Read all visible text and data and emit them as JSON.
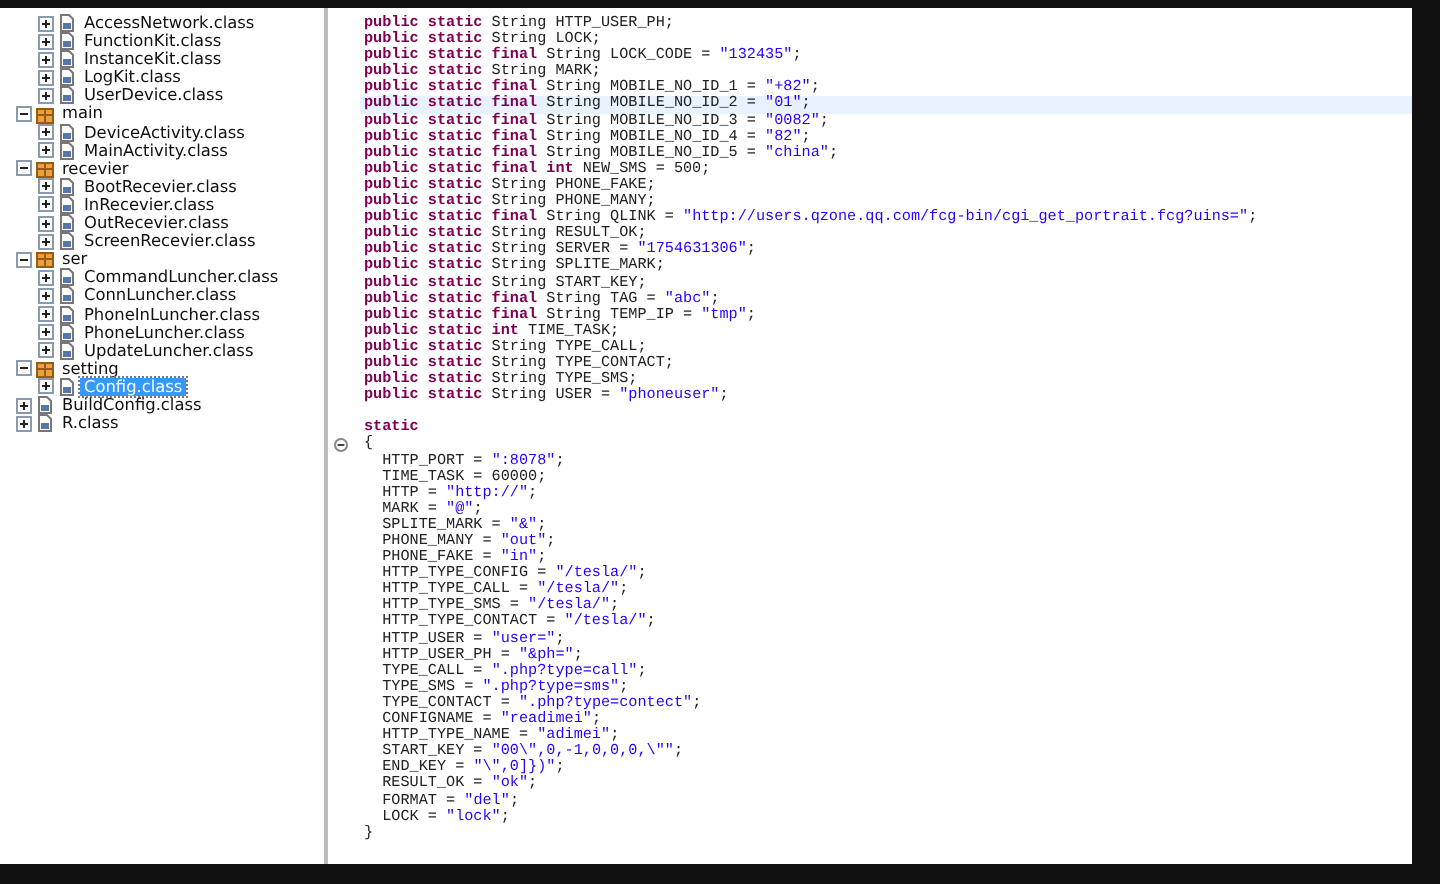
{
  "tree": [
    {
      "children": [
        {
          "label": "AccessNetwork.class",
          "kind": "class",
          "expanded": false,
          "selected": false
        },
        {
          "label": "FunctionKit.class",
          "kind": "class",
          "expanded": false,
          "selected": false
        },
        {
          "label": "InstanceKit.class",
          "kind": "class",
          "expanded": false,
          "selected": false
        },
        {
          "label": "LogKit.class",
          "kind": "class",
          "expanded": false,
          "selected": false
        },
        {
          "label": "UserDevice.class",
          "kind": "class",
          "expanded": false,
          "selected": false
        }
      ]
    },
    {
      "label": "main",
      "kind": "package",
      "expanded": true,
      "selected": false,
      "children": [
        {
          "label": "DeviceActivity.class",
          "kind": "class",
          "expanded": false,
          "selected": false
        },
        {
          "label": "MainActivity.class",
          "kind": "class",
          "expanded": false,
          "selected": false
        }
      ]
    },
    {
      "label": "recevier",
      "kind": "package",
      "expanded": true,
      "selected": false,
      "children": [
        {
          "label": "BootRecevier.class",
          "kind": "class",
          "expanded": false,
          "selected": false
        },
        {
          "label": "InRecevier.class",
          "kind": "class",
          "expanded": false,
          "selected": false
        },
        {
          "label": "OutRecevier.class",
          "kind": "class",
          "expanded": false,
          "selected": false
        },
        {
          "label": "ScreenRecevier.class",
          "kind": "class",
          "expanded": false,
          "selected": false
        }
      ]
    },
    {
      "label": "ser",
      "kind": "package",
      "expanded": true,
      "selected": false,
      "children": [
        {
          "label": "CommandLuncher.class",
          "kind": "class",
          "expanded": false,
          "selected": false
        },
        {
          "label": "ConnLuncher.class",
          "kind": "class",
          "expanded": false,
          "selected": false
        },
        {
          "label": "PhoneInLuncher.class",
          "kind": "class",
          "expanded": false,
          "selected": false
        },
        {
          "label": "PhoneLuncher.class",
          "kind": "class",
          "expanded": false,
          "selected": false
        },
        {
          "label": "UpdateLuncher.class",
          "kind": "class",
          "expanded": false,
          "selected": false
        }
      ]
    },
    {
      "label": "setting",
      "kind": "package",
      "expanded": true,
      "selected": false,
      "children": [
        {
          "label": "Config.class",
          "kind": "class",
          "expanded": false,
          "selected": true
        }
      ]
    },
    {
      "label": "BuildConfig.class",
      "kind": "class",
      "expanded": false,
      "selected": false
    },
    {
      "label": "R.class",
      "kind": "class",
      "expanded": false,
      "selected": false
    }
  ],
  "code": [
    {
      "current": false,
      "fold": false,
      "segments": [
        {
          "kind": "keyword",
          "text": "public static"
        },
        {
          "kind": "plain",
          "text": " String HTTP_USER_PH;"
        }
      ]
    },
    {
      "current": false,
      "fold": false,
      "segments": [
        {
          "kind": "keyword",
          "text": "public static"
        },
        {
          "kind": "plain",
          "text": " String LOCK;"
        }
      ]
    },
    {
      "current": false,
      "fold": false,
      "segments": [
        {
          "kind": "keyword",
          "text": "public static final"
        },
        {
          "kind": "plain",
          "text": " String LOCK_CODE = "
        },
        {
          "kind": "string",
          "text": "\"132435\""
        },
        {
          "kind": "plain",
          "text": ";"
        }
      ]
    },
    {
      "current": false,
      "fold": false,
      "segments": [
        {
          "kind": "keyword",
          "text": "public static"
        },
        {
          "kind": "plain",
          "text": " String MARK;"
        }
      ]
    },
    {
      "current": false,
      "fold": false,
      "segments": [
        {
          "kind": "keyword",
          "text": "public static final"
        },
        {
          "kind": "plain",
          "text": " String MOBILE_NO_ID_1 = "
        },
        {
          "kind": "string",
          "text": "\"+82\""
        },
        {
          "kind": "plain",
          "text": ";"
        }
      ]
    },
    {
      "current": true,
      "fold": false,
      "segments": [
        {
          "kind": "keyword",
          "text": "public static final"
        },
        {
          "kind": "plain",
          "text": " String MOBILE_NO_ID_2 = "
        },
        {
          "kind": "string",
          "text": "\"01\""
        },
        {
          "kind": "plain",
          "text": ";"
        }
      ]
    },
    {
      "current": false,
      "fold": false,
      "segments": [
        {
          "kind": "keyword",
          "text": "public static final"
        },
        {
          "kind": "plain",
          "text": " String MOBILE_NO_ID_3 = "
        },
        {
          "kind": "string",
          "text": "\"0082\""
        },
        {
          "kind": "plain",
          "text": ";"
        }
      ]
    },
    {
      "current": false,
      "fold": false,
      "segments": [
        {
          "kind": "keyword",
          "text": "public static final"
        },
        {
          "kind": "plain",
          "text": " String MOBILE_NO_ID_4 = "
        },
        {
          "kind": "string",
          "text": "\"82\""
        },
        {
          "kind": "plain",
          "text": ";"
        }
      ]
    },
    {
      "current": false,
      "fold": false,
      "segments": [
        {
          "kind": "keyword",
          "text": "public static final"
        },
        {
          "kind": "plain",
          "text": " String MOBILE_NO_ID_5 = "
        },
        {
          "kind": "string",
          "text": "\"china\""
        },
        {
          "kind": "plain",
          "text": ";"
        }
      ]
    },
    {
      "current": false,
      "fold": false,
      "segments": [
        {
          "kind": "keyword",
          "text": "public static final int"
        },
        {
          "kind": "plain",
          "text": " NEW_SMS = 500;"
        }
      ]
    },
    {
      "current": false,
      "fold": false,
      "segments": [
        {
          "kind": "keyword",
          "text": "public static"
        },
        {
          "kind": "plain",
          "text": " String PHONE_FAKE;"
        }
      ]
    },
    {
      "current": false,
      "fold": false,
      "segments": [
        {
          "kind": "keyword",
          "text": "public static"
        },
        {
          "kind": "plain",
          "text": " String PHONE_MANY;"
        }
      ]
    },
    {
      "current": false,
      "fold": false,
      "segments": [
        {
          "kind": "keyword",
          "text": "public static final"
        },
        {
          "kind": "plain",
          "text": " String QLINK = "
        },
        {
          "kind": "string",
          "text": "\"http://users.qzone.qq.com/fcg-bin/cgi_get_portrait.fcg?uins=\""
        },
        {
          "kind": "plain",
          "text": ";"
        }
      ]
    },
    {
      "current": false,
      "fold": false,
      "segments": [
        {
          "kind": "keyword",
          "text": "public static"
        },
        {
          "kind": "plain",
          "text": " String RESULT_OK;"
        }
      ]
    },
    {
      "current": false,
      "fold": false,
      "segments": [
        {
          "kind": "keyword",
          "text": "public static"
        },
        {
          "kind": "plain",
          "text": " String SERVER = "
        },
        {
          "kind": "string",
          "text": "\"1754631306\""
        },
        {
          "kind": "plain",
          "text": ";"
        }
      ]
    },
    {
      "current": false,
      "fold": false,
      "segments": [
        {
          "kind": "keyword",
          "text": "public static"
        },
        {
          "kind": "plain",
          "text": " String SPLITE_MARK;"
        }
      ]
    },
    {
      "current": false,
      "fold": false,
      "segments": [
        {
          "kind": "keyword",
          "text": "public static"
        },
        {
          "kind": "plain",
          "text": " String START_KEY;"
        }
      ]
    },
    {
      "current": false,
      "fold": false,
      "segments": [
        {
          "kind": "keyword",
          "text": "public static final"
        },
        {
          "kind": "plain",
          "text": " String TAG = "
        },
        {
          "kind": "string",
          "text": "\"abc\""
        },
        {
          "kind": "plain",
          "text": ";"
        }
      ]
    },
    {
      "current": false,
      "fold": false,
      "segments": [
        {
          "kind": "keyword",
          "text": "public static final"
        },
        {
          "kind": "plain",
          "text": " String TEMP_IP = "
        },
        {
          "kind": "string",
          "text": "\"tmp\""
        },
        {
          "kind": "plain",
          "text": ";"
        }
      ]
    },
    {
      "current": false,
      "fold": false,
      "segments": [
        {
          "kind": "keyword",
          "text": "public static int"
        },
        {
          "kind": "plain",
          "text": " TIME_TASK;"
        }
      ]
    },
    {
      "current": false,
      "fold": false,
      "segments": [
        {
          "kind": "keyword",
          "text": "public static"
        },
        {
          "kind": "plain",
          "text": " String TYPE_CALL;"
        }
      ]
    },
    {
      "current": false,
      "fold": false,
      "segments": [
        {
          "kind": "keyword",
          "text": "public static"
        },
        {
          "kind": "plain",
          "text": " String TYPE_CONTACT;"
        }
      ]
    },
    {
      "current": false,
      "fold": false,
      "segments": [
        {
          "kind": "keyword",
          "text": "public static"
        },
        {
          "kind": "plain",
          "text": " String TYPE_SMS;"
        }
      ]
    },
    {
      "current": false,
      "fold": false,
      "segments": [
        {
          "kind": "keyword",
          "text": "public static"
        },
        {
          "kind": "plain",
          "text": " String USER = "
        },
        {
          "kind": "string",
          "text": "\"phoneuser\""
        },
        {
          "kind": "plain",
          "text": ";"
        }
      ]
    },
    {
      "current": false,
      "fold": false
    },
    {
      "current": false,
      "fold": false,
      "segments": [
        {
          "kind": "keyword",
          "text": "static"
        }
      ]
    },
    {
      "current": false,
      "fold": true,
      "segments": [
        {
          "kind": "plain",
          "text": "{"
        }
      ]
    },
    {
      "current": false,
      "fold": false,
      "segments": [
        {
          "kind": "plain",
          "text": "  HTTP_PORT = "
        },
        {
          "kind": "string",
          "text": "\":8078\""
        },
        {
          "kind": "plain",
          "text": ";"
        }
      ]
    },
    {
      "current": false,
      "fold": false,
      "segments": [
        {
          "kind": "plain",
          "text": "  TIME_TASK = 60000;"
        }
      ]
    },
    {
      "current": false,
      "fold": false,
      "segments": [
        {
          "kind": "plain",
          "text": "  HTTP = "
        },
        {
          "kind": "string",
          "text": "\"http://\""
        },
        {
          "kind": "plain",
          "text": ";"
        }
      ]
    },
    {
      "current": false,
      "fold": false,
      "segments": [
        {
          "kind": "plain",
          "text": "  MARK = "
        },
        {
          "kind": "string",
          "text": "\"@\""
        },
        {
          "kind": "plain",
          "text": ";"
        }
      ]
    },
    {
      "current": false,
      "fold": false,
      "segments": [
        {
          "kind": "plain",
          "text": "  SPLITE_MARK = "
        },
        {
          "kind": "string",
          "text": "\"&\""
        },
        {
          "kind": "plain",
          "text": ";"
        }
      ]
    },
    {
      "current": false,
      "fold": false,
      "segments": [
        {
          "kind": "plain",
          "text": "  PHONE_MANY = "
        },
        {
          "kind": "string",
          "text": "\"out\""
        },
        {
          "kind": "plain",
          "text": ";"
        }
      ]
    },
    {
      "current": false,
      "fold": false,
      "segments": [
        {
          "kind": "plain",
          "text": "  PHONE_FAKE = "
        },
        {
          "kind": "string",
          "text": "\"in\""
        },
        {
          "kind": "plain",
          "text": ";"
        }
      ]
    },
    {
      "current": false,
      "fold": false,
      "segments": [
        {
          "kind": "plain",
          "text": "  HTTP_TYPE_CONFIG = "
        },
        {
          "kind": "string",
          "text": "\"/tesla/\""
        },
        {
          "kind": "plain",
          "text": ";"
        }
      ]
    },
    {
      "current": false,
      "fold": false,
      "segments": [
        {
          "kind": "plain",
          "text": "  HTTP_TYPE_CALL = "
        },
        {
          "kind": "string",
          "text": "\"/tesla/\""
        },
        {
          "kind": "plain",
          "text": ";"
        }
      ]
    },
    {
      "current": false,
      "fold": false,
      "segments": [
        {
          "kind": "plain",
          "text": "  HTTP_TYPE_SMS = "
        },
        {
          "kind": "string",
          "text": "\"/tesla/\""
        },
        {
          "kind": "plain",
          "text": ";"
        }
      ]
    },
    {
      "current": false,
      "fold": false,
      "segments": [
        {
          "kind": "plain",
          "text": "  HTTP_TYPE_CONTACT = "
        },
        {
          "kind": "string",
          "text": "\"/tesla/\""
        },
        {
          "kind": "plain",
          "text": ";"
        }
      ]
    },
    {
      "current": false,
      "fold": false,
      "segments": [
        {
          "kind": "plain",
          "text": "  HTTP_USER = "
        },
        {
          "kind": "string",
          "text": "\"user=\""
        },
        {
          "kind": "plain",
          "text": ";"
        }
      ]
    },
    {
      "current": false,
      "fold": false,
      "segments": [
        {
          "kind": "plain",
          "text": "  HTTP_USER_PH = "
        },
        {
          "kind": "string",
          "text": "\"&ph=\""
        },
        {
          "kind": "plain",
          "text": ";"
        }
      ]
    },
    {
      "current": false,
      "fold": false,
      "segments": [
        {
          "kind": "plain",
          "text": "  TYPE_CALL = "
        },
        {
          "kind": "string",
          "text": "\".php?type=call\""
        },
        {
          "kind": "plain",
          "text": ";"
        }
      ]
    },
    {
      "current": false,
      "fold": false,
      "segments": [
        {
          "kind": "plain",
          "text": "  TYPE_SMS = "
        },
        {
          "kind": "string",
          "text": "\".php?type=sms\""
        },
        {
          "kind": "plain",
          "text": ";"
        }
      ]
    },
    {
      "current": false,
      "fold": false,
      "segments": [
        {
          "kind": "plain",
          "text": "  TYPE_CONTACT = "
        },
        {
          "kind": "string",
          "text": "\".php?type=contect\""
        },
        {
          "kind": "plain",
          "text": ";"
        }
      ]
    },
    {
      "current": false,
      "fold": false,
      "segments": [
        {
          "kind": "plain",
          "text": "  CONFIGNAME = "
        },
        {
          "kind": "string",
          "text": "\"readimei\""
        },
        {
          "kind": "plain",
          "text": ";"
        }
      ]
    },
    {
      "current": false,
      "fold": false,
      "segments": [
        {
          "kind": "plain",
          "text": "  HTTP_TYPE_NAME = "
        },
        {
          "kind": "string",
          "text": "\"adimei\""
        },
        {
          "kind": "plain",
          "text": ";"
        }
      ]
    },
    {
      "current": false,
      "fold": false,
      "segments": [
        {
          "kind": "plain",
          "text": "  START_KEY = "
        },
        {
          "kind": "string",
          "text": "\"00\\\",0,-1,0,0,0,\\\"\""
        },
        {
          "kind": "plain",
          "text": ";"
        }
      ]
    },
    {
      "current": false,
      "fold": false,
      "segments": [
        {
          "kind": "plain",
          "text": "  END_KEY = "
        },
        {
          "kind": "string",
          "text": "\"\\\",0]})\""
        },
        {
          "kind": "plain",
          "text": ";"
        }
      ]
    },
    {
      "current": false,
      "fold": false,
      "segments": [
        {
          "kind": "plain",
          "text": "  RESULT_OK = "
        },
        {
          "kind": "string",
          "text": "\"ok\""
        },
        {
          "kind": "plain",
          "text": ";"
        }
      ]
    },
    {
      "current": false,
      "fold": false,
      "segments": [
        {
          "kind": "plain",
          "text": "  FORMAT = "
        },
        {
          "kind": "string",
          "text": "\"del\""
        },
        {
          "kind": "plain",
          "text": ";"
        }
      ]
    },
    {
      "current": false,
      "fold": false,
      "segments": [
        {
          "kind": "plain",
          "text": "  LOCK = "
        },
        {
          "kind": "string",
          "text": "\"lock\""
        },
        {
          "kind": "plain",
          "text": ";"
        }
      ]
    },
    {
      "current": false,
      "fold": false,
      "segments": [
        {
          "kind": "plain",
          "text": "}"
        }
      ]
    }
  ]
}
